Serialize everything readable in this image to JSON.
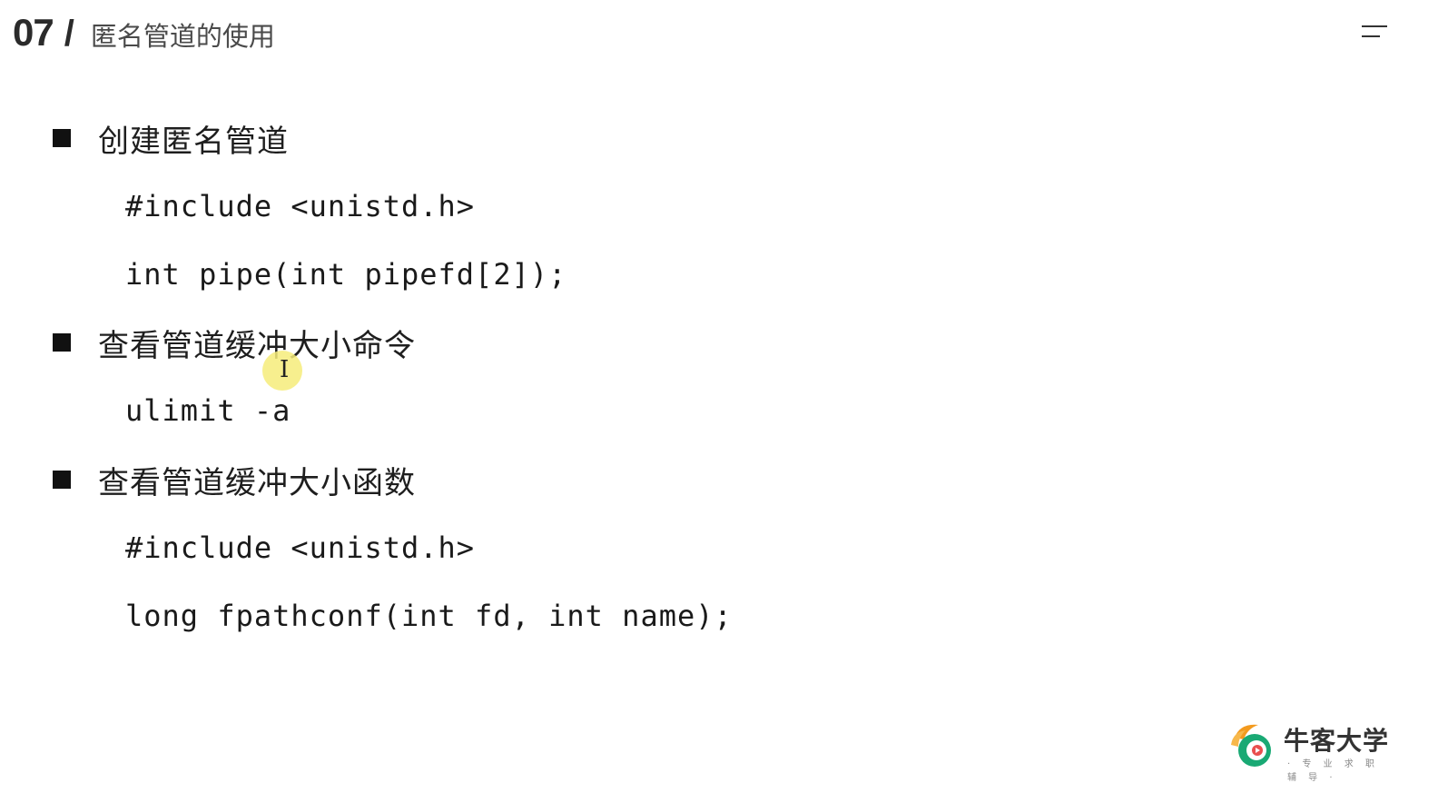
{
  "header": {
    "section_number": "07",
    "separator": "/",
    "title": "匿名管道的使用"
  },
  "sections": [
    {
      "heading": "创建匿名管道",
      "code": [
        "#include <unistd.h>",
        "int pipe(int pipefd[2]);"
      ]
    },
    {
      "heading": "查看管道缓冲大小命令",
      "code": [
        "ulimit -a"
      ]
    },
    {
      "heading": "查看管道缓冲大小函数",
      "code": [
        "#include <unistd.h>",
        "long fpathconf(int fd, int name);"
      ]
    }
  ],
  "logo": {
    "name": "牛客大学",
    "tagline": "· 专 业 求 职 辅 导 ·"
  },
  "icons": {
    "menu": "menu-icon",
    "cursor": "text-cursor-icon",
    "logo": "nowcoder-logo-icon"
  },
  "colors": {
    "logo_orange": "#f39a1e",
    "logo_green": "#19a974",
    "highlight": "#f6ec7a"
  }
}
